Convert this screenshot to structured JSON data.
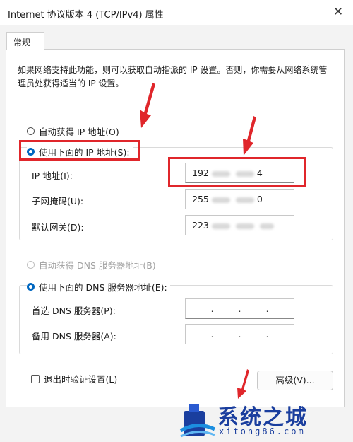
{
  "window": {
    "title": "Internet 协议版本 4 (TCP/IPv4) 属性",
    "close_glyph": "✕"
  },
  "tabs": [
    {
      "label": "常规",
      "selected": true
    }
  ],
  "description": "如果网络支持此功能，则可以获取自动指派的 IP 设置。否则，你需要从网络系统管理员处获得适当的 IP 设置。",
  "ip_section": {
    "auto_radio": "自动获得 IP 地址(O)",
    "manual_radio": "使用下面的 IP 地址(S):",
    "selected": "manual",
    "fields": {
      "ip_label": "IP 地址(I):",
      "ip_value": {
        "first": "192",
        "last": "4"
      },
      "subnet_label": "子网掩码(U):",
      "subnet_value": {
        "first": "255",
        "last": "0"
      },
      "gateway_label": "默认网关(D):",
      "gateway_value": {
        "first": "223",
        "last": ""
      }
    }
  },
  "dns_section": {
    "auto_radio": "自动获得 DNS 服务器地址(B)",
    "auto_disabled": true,
    "manual_radio": "使用下面的 DNS 服务器地址(E):",
    "selected": "manual",
    "preferred_label": "首选 DNS 服务器(P):",
    "alternate_label": "备用 DNS 服务器(A):",
    "dot": "."
  },
  "validate_checkbox": {
    "label": "退出时验证设置(L)",
    "checked": false
  },
  "advanced_button": "高级(V)...",
  "watermark": {
    "text": "系统之城",
    "url": "xitong86.com"
  },
  "colors": {
    "highlight": "#e0262b",
    "accent": "#0067c0",
    "watermark": "#1a3e9e"
  }
}
